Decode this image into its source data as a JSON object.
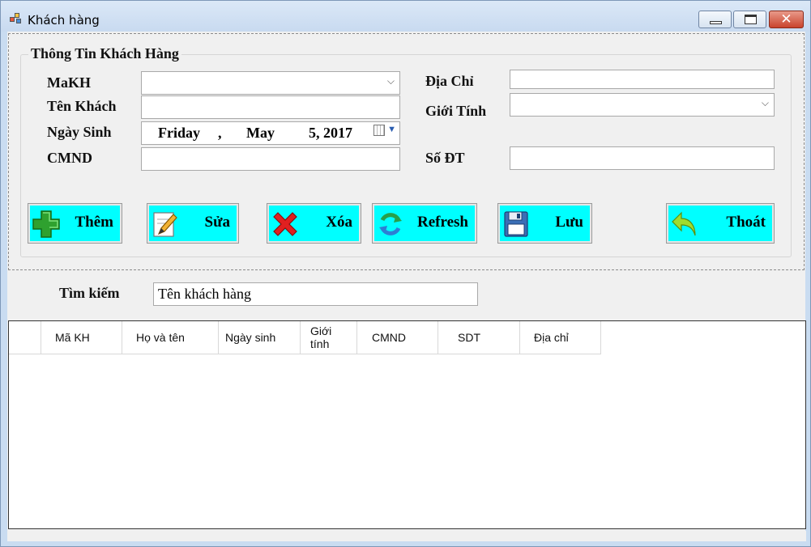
{
  "window": {
    "title": "Khách hàng",
    "controls": {
      "minimize": "minimize",
      "maximize": "maximize",
      "close": "✕"
    }
  },
  "form": {
    "group_title": "Thông Tin Khách Hàng",
    "labels": {
      "makh": "MaKH",
      "ten_khach": "Tên Khách",
      "ngay_sinh": "Ngày Sinh",
      "cmnd": "CMND",
      "dia_chi": "Địa Chỉ",
      "gioi_tinh": "Giới Tính",
      "so_dt": "Số ĐT"
    },
    "values": {
      "makh": "",
      "ten_khach": "",
      "ngay_sinh": {
        "weekday": "Friday",
        "sep": ",",
        "month": "May",
        "day_year": "5, 2017"
      },
      "cmnd": "",
      "dia_chi": "",
      "gioi_tinh": "",
      "so_dt": ""
    }
  },
  "buttons": {
    "them": "Thêm",
    "sua": "Sửa",
    "xoa": "Xóa",
    "refresh": "Refresh",
    "luu": "Lưu",
    "thoat": "Thoát"
  },
  "search": {
    "label": "Tìm kiếm",
    "value": "Tên khách hàng"
  },
  "grid": {
    "columns": [
      "",
      "Mã KH",
      "Họ và tên",
      "Ngày sinh",
      "Giới tính",
      "CMND",
      "SDT",
      "Địa chỉ"
    ]
  },
  "icons": {
    "app": "app-window-icon",
    "add": "plus-icon",
    "edit": "pencil-icon",
    "delete": "x-icon",
    "refresh": "refresh-icon",
    "save": "floppy-disk-icon",
    "exit": "back-arrow-icon",
    "calendar": "calendar-icon"
  },
  "colors": {
    "button_bg": "#00ffff",
    "client_bg": "#f0f0f0",
    "titlebar": "#c8daf0"
  }
}
